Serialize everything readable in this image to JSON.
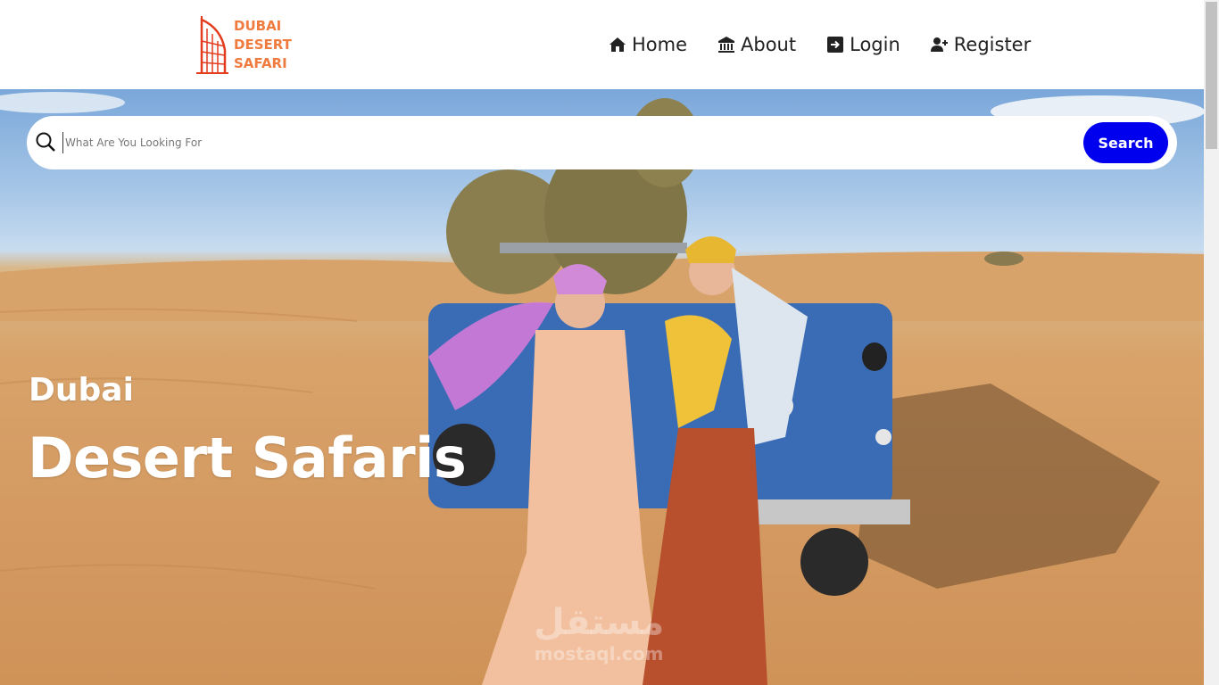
{
  "logo": {
    "line1": "DUBAI",
    "line2": "DESERT",
    "line3": "SAFARI"
  },
  "nav": [
    {
      "label": "Home",
      "icon": "home-icon"
    },
    {
      "label": "About",
      "icon": "bank-icon"
    },
    {
      "label": "Login",
      "icon": "sign-in-icon"
    },
    {
      "label": "Register",
      "icon": "user-plus-icon"
    }
  ],
  "search": {
    "placeholder": "What Are You Looking For",
    "value": "",
    "button_label": "Search"
  },
  "hero": {
    "subtitle": "Dubai",
    "title": "Desert Safaris"
  },
  "watermark": {
    "line1": "مستقل",
    "line2": "mostaql.com"
  },
  "colors": {
    "brand": "#f07b3f",
    "search_button": "#0000ee"
  }
}
